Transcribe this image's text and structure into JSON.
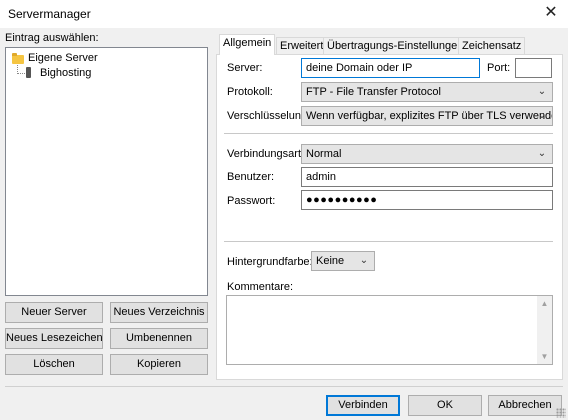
{
  "window": {
    "title": "Servermanager",
    "close_glyph": "✕"
  },
  "left": {
    "select_label": "Eintrag auswählen:",
    "tree": {
      "root": "Eigene Server",
      "child": "Bighosting"
    },
    "buttons": {
      "new_server": "Neuer Server",
      "new_folder": "Neues Verzeichnis",
      "new_bookmark": "Neues Lesezeichen",
      "rename": "Umbenennen",
      "delete": "Löschen",
      "copy": "Kopieren"
    }
  },
  "tabs": [
    "Allgemein",
    "Erweitert",
    "Übertragungs-Einstellungen",
    "Zeichensatz"
  ],
  "general": {
    "server_label": "Server:",
    "server_value": "deine Domain oder IP",
    "port_label": "Port:",
    "port_value": "",
    "protocol_label": "Protokoll:",
    "protocol_value": "FTP - File Transfer Protocol",
    "encryption_label": "Verschlüsselung:",
    "encryption_value": "Wenn verfügbar, explizites FTP über TLS verwenden",
    "logon_label": "Verbindungsart:",
    "logon_value": "Normal",
    "user_label": "Benutzer:",
    "user_value": "admin",
    "password_label": "Passwort:",
    "password_value": "●●●●●●●●●●",
    "bgcolor_label": "Hintergrundfarbe:",
    "bgcolor_value": "Keine",
    "comments_label": "Kommentare:",
    "comments_value": ""
  },
  "footer": {
    "connect": "Verbinden",
    "ok": "OK",
    "cancel": "Abbrechen"
  },
  "colors": {
    "accent": "#0078d7",
    "background": "#f0f0f0",
    "folder": "#f5c542"
  },
  "icons": {
    "folder": "folder-icon",
    "server": "server-icon",
    "dropdown": "chevron-down-icon"
  }
}
